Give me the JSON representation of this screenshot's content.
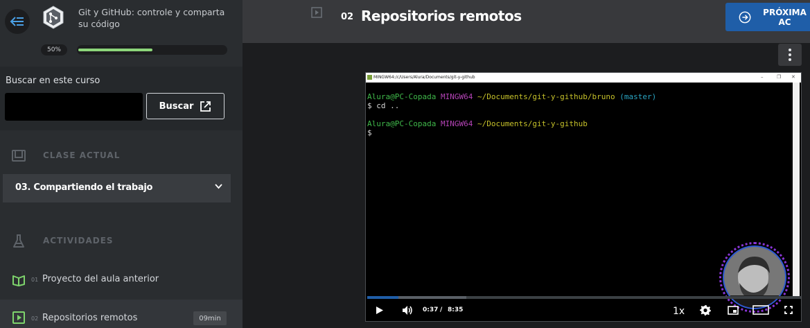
{
  "sidebar": {
    "course_title": "Git y GitHub: controle y comparta su código",
    "progress_label": "50%",
    "progress_value": 0.5,
    "search_label": "Buscar en este curso",
    "search_placeholder": "",
    "search_button": "Buscar",
    "current_class_heading": "CLASE ACTUAL",
    "current_class": "03. Compartiendo el trabajo",
    "activities_heading": "ACTIVIDADES",
    "activities": [
      {
        "num": "01",
        "label": "Proyecto del aula anterior",
        "duration": ""
      },
      {
        "num": "02",
        "label": "Repositorios remotos",
        "duration": "09min"
      }
    ],
    "colors": {
      "progress": "#8cd67a",
      "icon_green": "#7ed46c"
    }
  },
  "header": {
    "lesson_number": "02",
    "lesson_title": "Repositorios remotos",
    "next_button": "PRÓXIMA AC",
    "next_color": "#1f5ea8"
  },
  "video": {
    "window_title": "MINGW64:/c/Users/Alura/Documents/git-y-github",
    "terminal": [
      {
        "user": "Alura@PC-Copada",
        "env": "MINGW64",
        "path": "~/Documents/git-y-github/bruno",
        "branch": "(master)"
      },
      {
        "cmd": "$ cd .."
      },
      {
        "user": "Alura@PC-Copada",
        "env": "MINGW64",
        "path": "~/Documents/git-y-github",
        "branch": ""
      },
      {
        "cmd": "$"
      }
    ],
    "current_time": "0:37",
    "separator": "/",
    "duration": "8:35",
    "played_fraction": 0.072,
    "buffered_fraction": 0.228,
    "speed": "1x"
  }
}
